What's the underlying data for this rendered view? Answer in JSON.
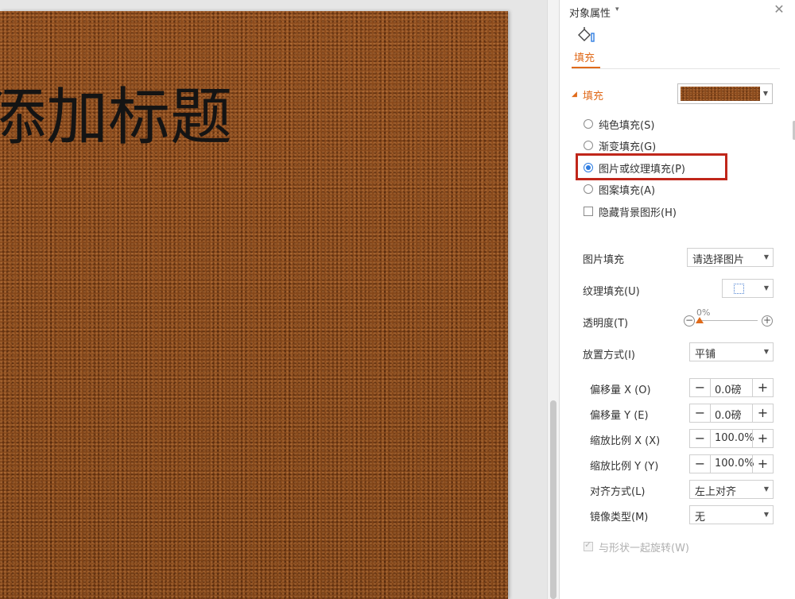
{
  "slide": {
    "title": "添加标题"
  },
  "panel": {
    "title": "对象属性",
    "tab_label": "填充",
    "section_title": "填充",
    "fill_options": [
      {
        "label": "纯色填充(S)",
        "checked": false
      },
      {
        "label": "渐变填充(G)",
        "checked": false
      },
      {
        "label": "图片或纹理填充(P)",
        "checked": true
      },
      {
        "label": "图案填充(A)",
        "checked": false
      }
    ],
    "hide_bg_label": "隐藏背景图形(H)",
    "picture_fill": {
      "label": "图片填充",
      "value": "请选择图片"
    },
    "texture_fill": {
      "label": "纹理填充(U)"
    },
    "transparency": {
      "label": "透明度(T)",
      "value": "0%"
    },
    "placement": {
      "label": "放置方式(I)",
      "value": "平铺"
    },
    "offset_x": {
      "label": "偏移量 X (O)",
      "value": "0.0磅"
    },
    "offset_y": {
      "label": "偏移量 Y (E)",
      "value": "0.0磅"
    },
    "scale_x": {
      "label": "缩放比例 X (X)",
      "value": "100.0%"
    },
    "scale_y": {
      "label": "缩放比例 Y (Y)",
      "value": "100.0%"
    },
    "alignment": {
      "label": "对齐方式(L)",
      "value": "左上对齐"
    },
    "mirror": {
      "label": "镜像类型(M)",
      "value": "无"
    },
    "rotate_with_shape": {
      "label": "与形状一起旋转(W)",
      "checked": true,
      "disabled": true
    }
  },
  "colors": {
    "accent": "#e06a1a",
    "highlight_box": "#c0261a",
    "radio_selected": "#2f7de1",
    "leather_texture": "#8a4a1c"
  },
  "icons": {
    "fill_tab": "paint-bucket-icon",
    "close": "close-icon"
  }
}
